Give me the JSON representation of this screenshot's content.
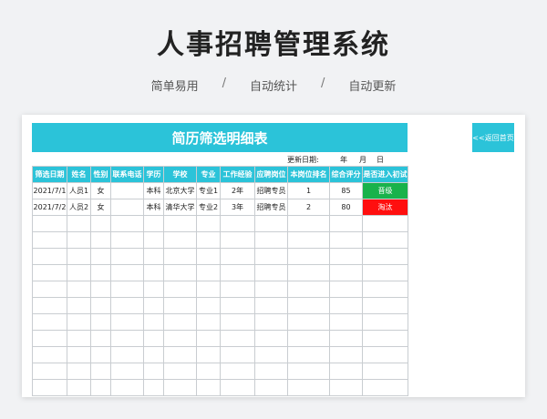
{
  "hero": {
    "title": "人事招聘管理系统",
    "subtitles": [
      "简单易用",
      "自动统计",
      "自动更新"
    ],
    "separator": "/"
  },
  "sheet": {
    "banner_title": "简历筛选明细表",
    "back_button_label": "<<返回首页",
    "date_label": "更新日期:",
    "date_year": "年",
    "date_month": "月",
    "date_day": "日",
    "columns": [
      "筛选日期",
      "姓名",
      "性别",
      "联系电话",
      "学历",
      "学校",
      "专业",
      "工作经验",
      "应聘岗位",
      "本岗位排名",
      "综合评分",
      "是否进入初试"
    ],
    "rows": [
      [
        "2021/7/1",
        "人员1",
        "女",
        "",
        "本科",
        "北京大学",
        "专业1",
        "2年",
        "招聘专员",
        "1",
        "85",
        "晋级"
      ],
      [
        "2021/7/2",
        "人员2",
        "女",
        "",
        "本科",
        "清华大学",
        "专业2",
        "3年",
        "招聘专员",
        "2",
        "80",
        "淘汰"
      ]
    ],
    "status_colors": {
      "晋级": "#19b24b",
      "淘汰": "#ff0f0f"
    },
    "accent_color": "#2bc3d9"
  }
}
